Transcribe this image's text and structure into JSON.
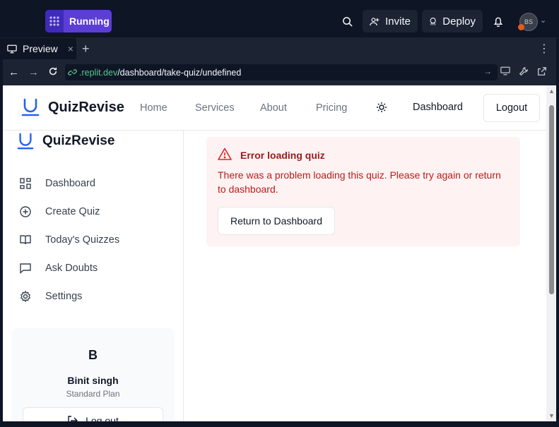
{
  "replit": {
    "run_label": "Running",
    "invite_label": "Invite",
    "deploy_label": "Deploy",
    "avatar_initials": "BS",
    "tab_label": "Preview",
    "url_host": ".replit.dev",
    "url_path": "/dashboard/take-quiz/undefined"
  },
  "header": {
    "brand": "QuizRevise",
    "nav": [
      "Home",
      "Services",
      "About",
      "Pricing"
    ],
    "dashboard_label": "Dashboard",
    "logout_label": "Logout"
  },
  "sidebar": {
    "brand": "QuizRevise",
    "items": [
      {
        "label": "Dashboard",
        "icon": "grid-icon"
      },
      {
        "label": "Create Quiz",
        "icon": "plus-circle-icon"
      },
      {
        "label": "Today's Quizzes",
        "icon": "book-open-icon"
      },
      {
        "label": "Ask Doubts",
        "icon": "message-square-icon"
      },
      {
        "label": "Settings",
        "icon": "gear-icon"
      }
    ],
    "user": {
      "initial": "B",
      "name": "Binit singh",
      "plan": "Standard Plan",
      "logout_label": "Log out"
    }
  },
  "error": {
    "title": "Error loading quiz",
    "message": "There was a problem loading this quiz. Please try again or return to dashboard.",
    "button_label": "Return to Dashboard"
  },
  "colors": {
    "brand_blue": "#2563eb",
    "error_bg": "#fef2f2",
    "error_text": "#b91c1c",
    "run_purple": "#5b3fd4"
  }
}
